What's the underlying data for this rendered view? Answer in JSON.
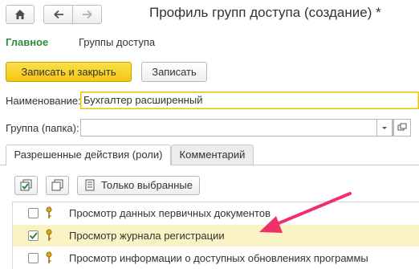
{
  "window": {
    "title": "Профиль групп доступа (создание) *"
  },
  "sections": {
    "main": "Главное",
    "groups": "Группы доступа"
  },
  "commands": {
    "save_close": "Записать и закрыть",
    "save": "Записать"
  },
  "form": {
    "name_label": "Наименование:",
    "name_value": "Бухгалтер расширенный",
    "group_label": "Группа (папка):",
    "group_value": ""
  },
  "tabs": [
    {
      "label": "Разрешенные действия (роли)"
    },
    {
      "label": "Комментарий"
    }
  ],
  "toolbar": {
    "only_selected": "Только выбранные"
  },
  "roles": [
    {
      "label": "Просмотр данных первичных документов",
      "checked": false
    },
    {
      "label": "Просмотр журнала регистрации",
      "checked": true
    },
    {
      "label": "Просмотр информации о доступных обновлениях программы",
      "checked": false
    }
  ],
  "colors": {
    "accent_green": "#2e8b3a",
    "primary_button": "#f3c612",
    "selected_row": "#faf3c3",
    "arrow": "#f0306b"
  }
}
